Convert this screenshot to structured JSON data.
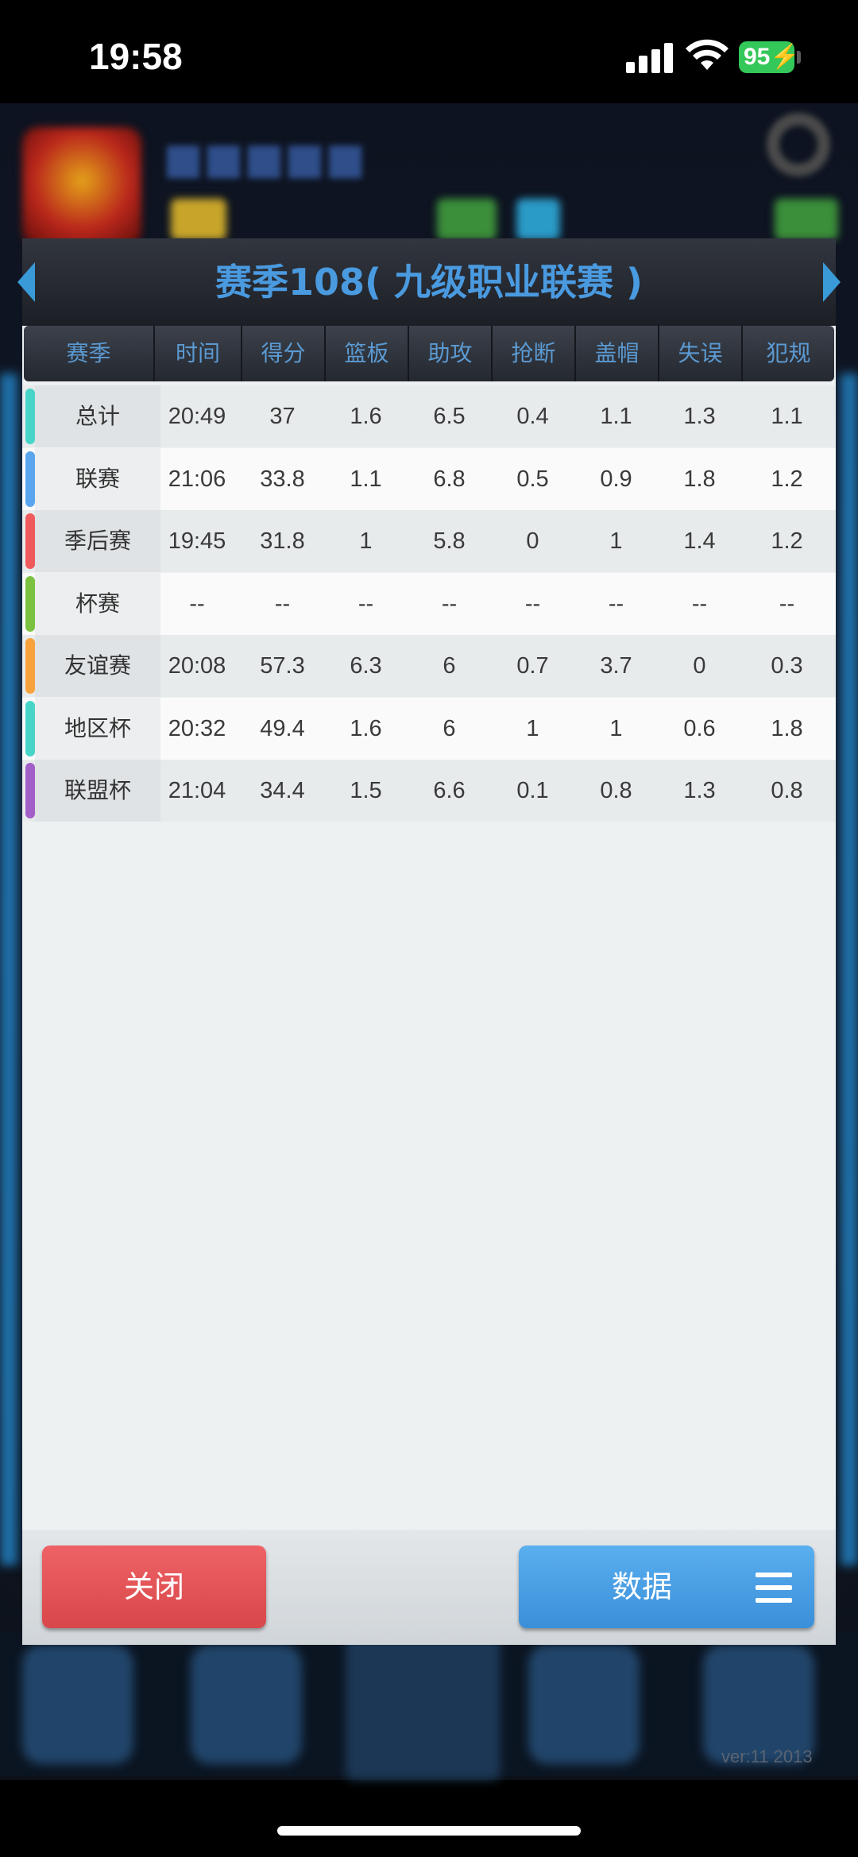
{
  "status_bar": {
    "time": "19:58",
    "battery": "95"
  },
  "dialog": {
    "title": "赛季108( 九级职业联赛 )",
    "columns": [
      "赛季",
      "时间",
      "得分",
      "篮板",
      "助攻",
      "抢断",
      "盖帽",
      "失误",
      "犯规"
    ],
    "rows": [
      {
        "label": "总计",
        "color": "#48d5c8",
        "values": [
          "20:49",
          "37",
          "1.6",
          "6.5",
          "0.4",
          "1.1",
          "1.3",
          "1.1"
        ]
      },
      {
        "label": "联赛",
        "color": "#5aa6ee",
        "values": [
          "21:06",
          "33.8",
          "1.1",
          "6.8",
          "0.5",
          "0.9",
          "1.8",
          "1.2"
        ]
      },
      {
        "label": "季后赛",
        "color": "#ef5a5d",
        "values": [
          "19:45",
          "31.8",
          "1",
          "5.8",
          "0",
          "1",
          "1.4",
          "1.2"
        ]
      },
      {
        "label": "杯赛",
        "color": "#7bc240",
        "values": [
          "--",
          "--",
          "--",
          "--",
          "--",
          "--",
          "--",
          "--"
        ]
      },
      {
        "label": "友谊赛",
        "color": "#f8a23d",
        "values": [
          "20:08",
          "57.3",
          "6.3",
          "6",
          "0.7",
          "3.7",
          "0",
          "0.3"
        ]
      },
      {
        "label": "地区杯",
        "color": "#48d5c8",
        "values": [
          "20:32",
          "49.4",
          "1.6",
          "6",
          "1",
          "1",
          "0.6",
          "1.8"
        ]
      },
      {
        "label": "联盟杯",
        "color": "#a35fc8",
        "values": [
          "21:04",
          "34.4",
          "1.5",
          "6.6",
          "0.1",
          "0.8",
          "1.3",
          "0.8"
        ]
      }
    ],
    "buttons": {
      "close": "关闭",
      "data": "数据"
    }
  },
  "background": {
    "version": "ver:11  2013"
  },
  "icons": [
    "arrow-left-icon",
    "arrow-right-icon",
    "menu-icon",
    "signal-icon",
    "wifi-icon",
    "battery-icon"
  ]
}
